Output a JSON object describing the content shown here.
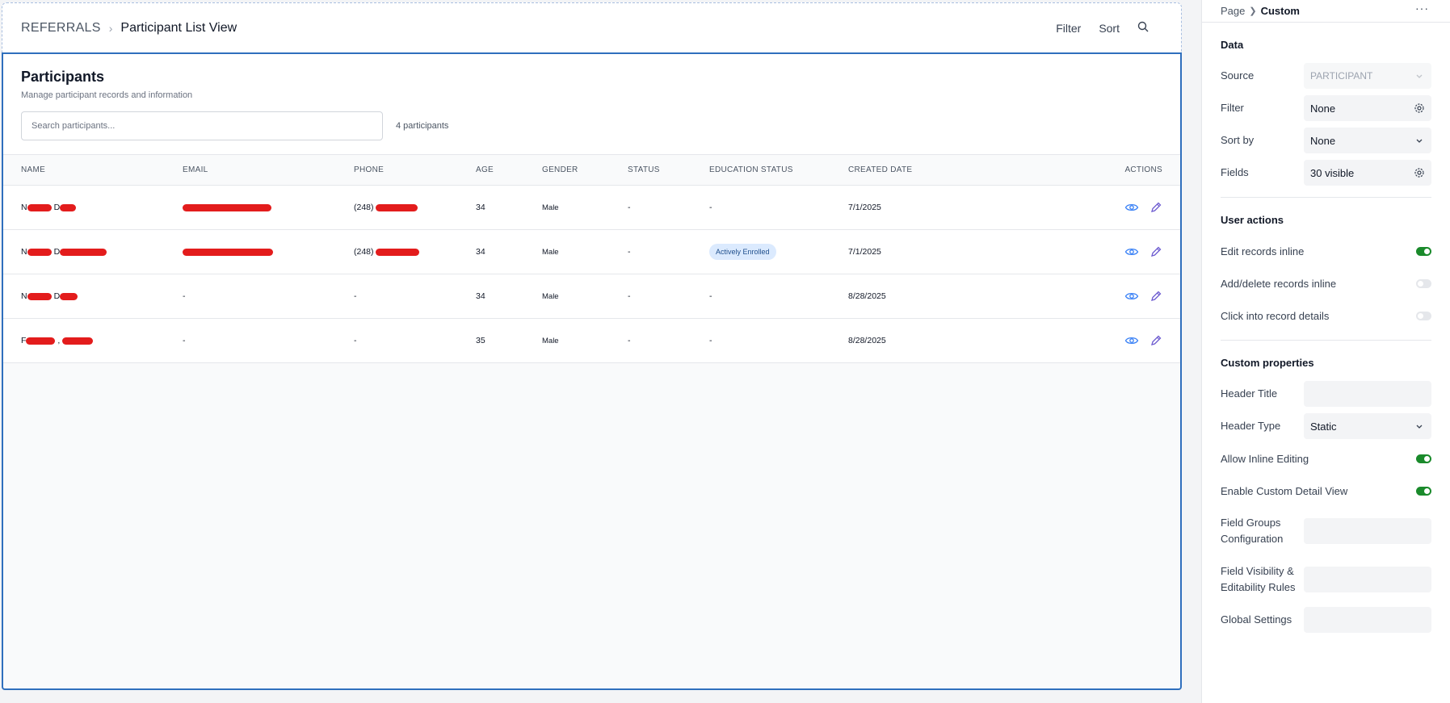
{
  "breadcrumb": {
    "root": "REFERRALS",
    "current": "Participant List View"
  },
  "top_actions": {
    "filter": "Filter",
    "sort": "Sort"
  },
  "header": {
    "title": "Participants",
    "subtitle": "Manage participant records and information",
    "search_placeholder": "Search participants...",
    "count": "4 participants"
  },
  "table": {
    "columns": [
      "NAME",
      "EMAIL",
      "PHONE",
      "AGE",
      "GENDER",
      "STATUS",
      "EDUCATION STATUS",
      "CREATED DATE",
      "ACTIONS"
    ],
    "rows": [
      {
        "name_prefix": "N",
        "email_prefix": "",
        "phone_prefix": "(248)",
        "age": "34",
        "gender": "Male",
        "status": "-",
        "education": "-",
        "created": "7/1/2025"
      },
      {
        "name_prefix": "N",
        "email_prefix": "",
        "phone_prefix": "(248)",
        "age": "34",
        "gender": "Male",
        "status": "-",
        "education": "Actively Enrolled",
        "created": "7/1/2025"
      },
      {
        "name_prefix": "N",
        "email_prefix": "-",
        "phone_prefix": "-",
        "age": "34",
        "gender": "Male",
        "status": "-",
        "education": "-",
        "created": "8/28/2025"
      },
      {
        "name_prefix": "F",
        "email_prefix": "-",
        "phone_prefix": "-",
        "age": "35",
        "gender": "Male",
        "status": "-",
        "education": "-",
        "created": "8/28/2025"
      }
    ]
  },
  "panel": {
    "head": {
      "page": "Page",
      "custom": "Custom",
      "more": "···"
    },
    "data_section": {
      "title": "Data",
      "source_label": "Source",
      "source_value": "PARTICIPANT",
      "filter_label": "Filter",
      "filter_value": "None",
      "sortby_label": "Sort by",
      "sortby_value": "None",
      "fields_label": "Fields",
      "fields_value": "30 visible"
    },
    "user_actions": {
      "title": "User actions",
      "edit_inline": "Edit records inline",
      "add_delete_inline": "Add/delete records inline",
      "click_into_details": "Click into record details",
      "edit_inline_on": true,
      "add_delete_inline_on": false,
      "click_into_details_on": false
    },
    "custom_properties": {
      "title": "Custom properties",
      "header_title_label": "Header Title",
      "header_type_label": "Header Type",
      "header_type_value": "Static",
      "allow_inline_label": "Allow Inline Editing",
      "enable_detail_label": "Enable Custom Detail View",
      "field_groups_label": "Field Groups Configuration",
      "field_visibility_label": "Field Visibility & Editability Rules",
      "global_settings_label": "Global Settings",
      "allow_inline_on": true,
      "enable_detail_on": true
    }
  },
  "colors": {
    "accent": "#2f6fbd",
    "toggle_on": "#1a8a2b",
    "redaction": "#e31c1c",
    "badge_bg": "#dbeafe"
  }
}
